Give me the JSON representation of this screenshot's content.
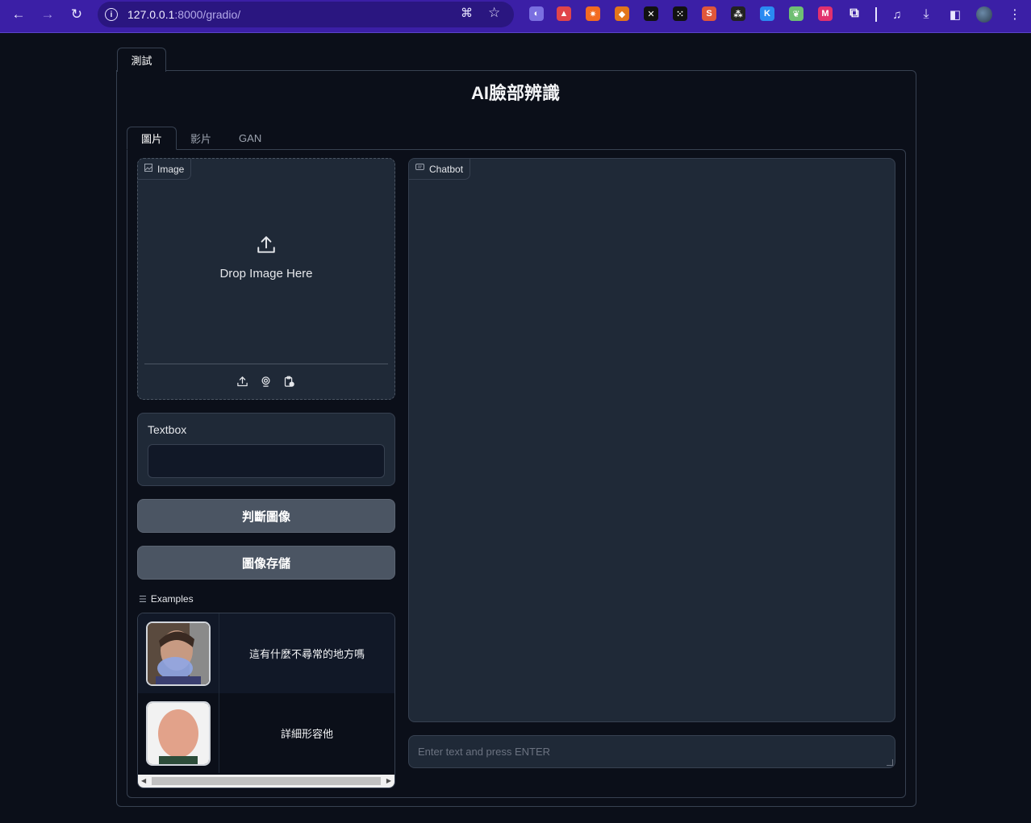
{
  "browser": {
    "url_host": "127.0.0.1",
    "url_rest": ":8000/gradio/",
    "extensions": [
      {
        "name": "ext-1-icon",
        "color": "#7a6fe0",
        "glyph": "◐"
      },
      {
        "name": "ext-2-icon",
        "color": "#e0454a",
        "glyph": "▲"
      },
      {
        "name": "ext-3-icon",
        "color": "#f26b21",
        "glyph": "✷"
      },
      {
        "name": "metamask-icon",
        "color": "#e2761b",
        "glyph": "◆"
      },
      {
        "name": "ext-x-icon",
        "color": "#111111",
        "glyph": "✕"
      },
      {
        "name": "ext-okx-icon",
        "color": "#111111",
        "glyph": "⁙"
      },
      {
        "name": "ext-s-icon",
        "color": "#e0573a",
        "glyph": "S"
      },
      {
        "name": "ext-dots-icon",
        "color": "#222222",
        "glyph": "⁂"
      },
      {
        "name": "ext-k-icon",
        "color": "#2a8bf2",
        "glyph": "K"
      },
      {
        "name": "ext-leaf-icon",
        "color": "#6fbf73",
        "glyph": "❦"
      },
      {
        "name": "ext-m-icon",
        "color": "#e2316e",
        "glyph": "M"
      },
      {
        "name": "extensions-puzzle-icon",
        "color": "transparent",
        "glyph": "⧉"
      }
    ]
  },
  "outer_tab": {
    "label": "測試"
  },
  "page_title": "AI臉部辨識",
  "inner_tabs": [
    {
      "label": "圖片",
      "active": true
    },
    {
      "label": "影片",
      "active": false
    },
    {
      "label": "GAN",
      "active": false
    }
  ],
  "image_input": {
    "label": "Image",
    "drop_text": "Drop Image Here"
  },
  "textbox": {
    "label": "Textbox",
    "value": ""
  },
  "buttons": {
    "judge": "判斷圖像",
    "save": "圖像存儲"
  },
  "examples": {
    "label": "Examples",
    "rows": [
      {
        "text": "這有什麼不尋常的地方嗎",
        "thumb": "face-young-man"
      },
      {
        "text": "詳細形容他",
        "thumb": "face-bald-man"
      }
    ]
  },
  "chatbot": {
    "label": "Chatbot",
    "placeholder": "Enter text and press ENTER"
  }
}
